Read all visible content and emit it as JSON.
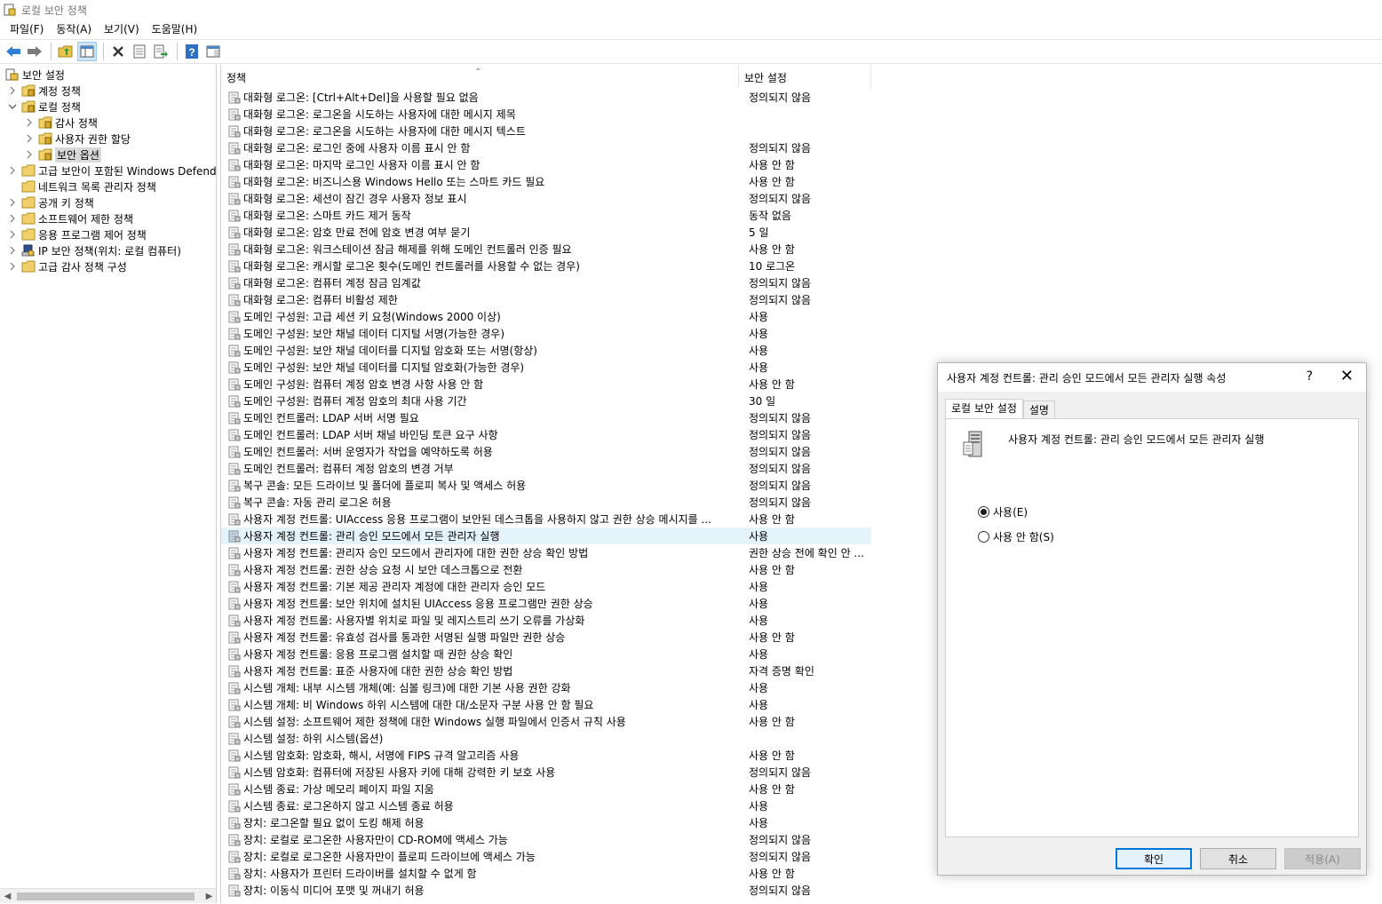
{
  "window": {
    "title": "로컬 보안 정책"
  },
  "menu": [
    "파일(F)",
    "동작(A)",
    "보기(V)",
    "도움말(H)"
  ],
  "toolbar": {
    "buttons": [
      "back-arrow-icon",
      "forward-arrow-icon",
      "up-folder-icon",
      "show-hide-tree-icon",
      "delete-icon",
      "properties-icon",
      "export-list-icon",
      "help-icon",
      "console-view-icon"
    ]
  },
  "tree": {
    "items": [
      {
        "label": "보안 설정",
        "level": 0,
        "expanded": true
      },
      {
        "label": "계정 정책",
        "level": 1,
        "expanded": false
      },
      {
        "label": "로컬 정책",
        "level": 1,
        "expanded": true
      },
      {
        "label": "감사 정책",
        "level": 2,
        "expanded": false
      },
      {
        "label": "사용자 권한 할당",
        "level": 2,
        "expanded": false
      },
      {
        "label": "보안 옵션",
        "level": 2,
        "expanded": false,
        "selected": true
      },
      {
        "label": "고급 보안이 포함된 Windows Defender 방화벽",
        "level": 1,
        "expanded": false
      },
      {
        "label": "네트워크 목록 관리자 정책",
        "level": 1,
        "leaf": true
      },
      {
        "label": "공개 키 정책",
        "level": 1,
        "expanded": false
      },
      {
        "label": "소프트웨어 제한 정책",
        "level": 1,
        "expanded": false
      },
      {
        "label": "응용 프로그램 제어 정책",
        "level": 1,
        "expanded": false
      },
      {
        "label": "IP 보안 정책(위치: 로컬 컴퓨터)",
        "level": 1,
        "expanded": false
      },
      {
        "label": "고급 감사 정책 구성",
        "level": 1,
        "expanded": false
      }
    ]
  },
  "list": {
    "columns": {
      "policy": "정책",
      "setting": "보안 설정"
    },
    "rows": [
      [
        "대화형 로그온: [Ctrl+Alt+Del]을 사용할 필요 없음",
        "정의되지 않음"
      ],
      [
        "대화형 로그온: 로그온을 시도하는 사용자에 대한 메시지 제목",
        ""
      ],
      [
        "대화형 로그온: 로그온을 시도하는 사용자에 대한 메시지 텍스트",
        ""
      ],
      [
        "대화형 로그온: 로그인 중에 사용자 이름 표시 안 함",
        "정의되지 않음"
      ],
      [
        "대화형 로그온: 마지막 로그인 사용자 이름 표시 안 함",
        "사용 안 함"
      ],
      [
        "대화형 로그온: 비즈니스용 Windows Hello 또는 스마트 카드 필요",
        "사용 안 함"
      ],
      [
        "대화형 로그온: 세션이 잠긴 경우 사용자 정보 표시",
        "정의되지 않음"
      ],
      [
        "대화형 로그온: 스마트 카드 제거 동작",
        "동작 없음"
      ],
      [
        "대화형 로그온: 암호 만료 전에 암호 변경 여부 묻기",
        "5 일"
      ],
      [
        "대화형 로그온: 워크스테이션 잠금 해제를 위해 도메인 컨트롤러 인증 필요",
        "사용 안 함"
      ],
      [
        "대화형 로그온: 캐시할 로그온 횟수(도메인 컨트롤러를 사용할 수 없는 경우)",
        "10 로그온"
      ],
      [
        "대화형 로그온: 컴퓨터 계정 잠금 임계값",
        "정의되지 않음"
      ],
      [
        "대화형 로그온: 컴퓨터 비활성 제한",
        "정의되지 않음"
      ],
      [
        "도메인 구성원: 고급 세션 키 요청(Windows 2000 이상)",
        "사용"
      ],
      [
        "도메인 구성원: 보안 채널 데이터 디지털 서명(가능한 경우)",
        "사용"
      ],
      [
        "도메인 구성원: 보안 채널 데이터를 디지털 암호화 또는 서명(항상)",
        "사용"
      ],
      [
        "도메인 구성원: 보안 채널 데이터를 디지털 암호화(가능한 경우)",
        "사용"
      ],
      [
        "도메인 구성원: 컴퓨터 계정 암호 변경 사항 사용 안 함",
        "사용 안 함"
      ],
      [
        "도메인 구성원: 컴퓨터 계정 암호의 최대 사용 기간",
        "30 일"
      ],
      [
        "도메인 컨트롤러: LDAP 서버 서명 필요",
        "정의되지 않음"
      ],
      [
        "도메인 컨트롤러: LDAP 서버 채널 바인딩 토큰 요구 사항",
        "정의되지 않음"
      ],
      [
        "도메인 컨트롤러: 서버 운영자가 작업을 예약하도록 허용",
        "정의되지 않음"
      ],
      [
        "도메인 컨트롤러: 컴퓨터 계정 암호의 변경 거부",
        "정의되지 않음"
      ],
      [
        "복구 콘솔: 모든 드라이브 및 폴더에 플로피 복사 및 액세스 허용",
        "정의되지 않음"
      ],
      [
        "복구 콘솔: 자동 관리 로그온 허용",
        "정의되지 않음"
      ],
      [
        "사용자 계정 컨트롤: UIAccess 응용 프로그램이 보안된 데스크톱을 사용하지 않고 권한 상승 메시지를 ...",
        "사용 안 함"
      ],
      [
        "사용자 계정 컨트롤: 관리 승인 모드에서 모든 관리자 실행",
        "사용"
      ],
      [
        "사용자 계정 컨트롤: 관리자 승인 모드에서 관리자에 대한 권한 상승 확인 방법",
        "권한 상승 전에 확인 안 ..."
      ],
      [
        "사용자 계정 컨트롤: 권한 상승 요청 시 보안 데스크톱으로 전환",
        "사용 안 함"
      ],
      [
        "사용자 계정 컨트롤: 기본 제공 관리자 계정에 대한 관리자 승인 모드",
        "사용"
      ],
      [
        "사용자 계정 컨트롤: 보안 위치에 설치된 UIAccess 응용 프로그램만 권한 상승",
        "사용"
      ],
      [
        "사용자 계정 컨트롤: 사용자별 위치로 파일 및 레지스트리 쓰기 오류를 가상화",
        "사용"
      ],
      [
        "사용자 계정 컨트롤: 유효성 검사를 통과한 서명된 실행 파일만 권한 상승",
        "사용 안 함"
      ],
      [
        "사용자 계정 컨트롤: 응용 프로그램 설치할 때 권한 상승 확인",
        "사용"
      ],
      [
        "사용자 계정 컨트롤: 표준 사용자에 대한 권한 상승 확인 방법",
        "자격 증명 확인"
      ],
      [
        "시스템 개체: 내부 시스템 개체(예: 심볼 링크)에 대한 기본 사용 권한 강화",
        "사용"
      ],
      [
        "시스템 개체: 비 Windows 하위 시스템에 대한 대/소문자 구분 사용 안 함 필요",
        "사용"
      ],
      [
        "시스템 설정: 소프트웨어 제한 정책에 대한 Windows 실행 파일에서 인증서 규칙 사용",
        "사용 안 함"
      ],
      [
        "시스템 설정: 하위 시스템(옵션)",
        ""
      ],
      [
        "시스템 암호화: 암호화, 해시, 서명에 FIPS 규격 알고리즘 사용",
        "사용 안 함"
      ],
      [
        "시스템 암호화: 컴퓨터에 저장된 사용자 키에 대해 강력한 키 보호 사용",
        "정의되지 않음"
      ],
      [
        "시스템 종료: 가상 메모리 페이지 파일 지움",
        "사용 안 함"
      ],
      [
        "시스템 종료: 로그온하지 않고 시스템 종료 허용",
        "사용"
      ],
      [
        "장치: 로그온할 필요 없이 도킹 해제 허용",
        "사용"
      ],
      [
        "장치: 로컬로 로그온한 사용자만이 CD-ROM에 액세스 가능",
        "정의되지 않음"
      ],
      [
        "장치: 로컬로 로그온한 사용자만이 플로피 드라이브에 액세스 가능",
        "정의되지 않음"
      ],
      [
        "장치: 사용자가 프린터 드라이버를 설치할 수 없게 함",
        "사용 안 함"
      ],
      [
        "장치: 이동식 미디어 포맷 및 꺼내기 허용",
        "정의되지 않음"
      ]
    ],
    "selected_index": 26
  },
  "dialog": {
    "title": "사용자 계정 컨트롤: 관리 승인 모드에서 모든 관리자 실행 속성",
    "help": "?",
    "close": "✕",
    "tabs": [
      "로컬 보안 설정",
      "설명"
    ],
    "heading": "사용자 계정 컨트롤: 관리 승인 모드에서 모든 관리자 실행",
    "radio_enabled": "사용(E)",
    "radio_disabled": "사용 안 함(S)",
    "selected": "enabled",
    "ok": "확인",
    "cancel": "취소",
    "apply": "적용(A)"
  },
  "colors": {
    "selection": "#e5f3fb",
    "tree_selection": "#d9d9d9",
    "default_button_border": "#0078d7"
  }
}
